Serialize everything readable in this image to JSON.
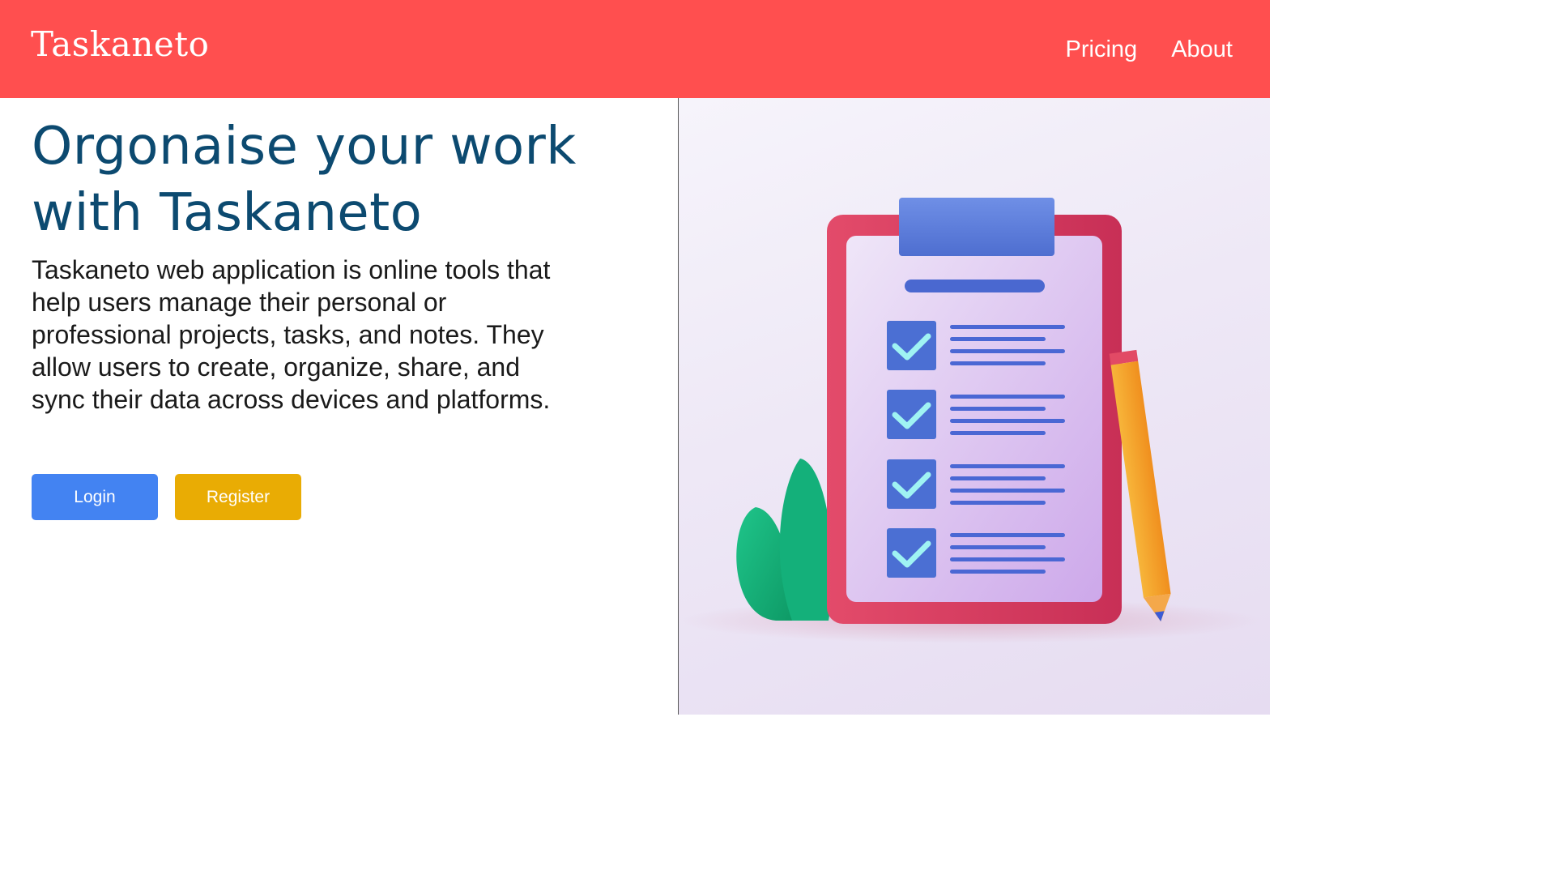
{
  "header": {
    "logo": "Taskaneto",
    "nav": [
      {
        "label": "Pricing"
      },
      {
        "label": "About"
      }
    ]
  },
  "main": {
    "headline": "Orgonaise your work with Taskaneto",
    "description": "Taskaneto web application is online tools that help users manage their personal or professional projects, tasks, and notes. They allow users to create, organize, share, and sync their data across devices and platforms.",
    "buttons": {
      "login": "Login",
      "register": "Register"
    }
  },
  "colors": {
    "header_bg": "#ff4f4f",
    "headline": "#0c4a70",
    "login_button": "#4383f2",
    "register_button": "#e9ac04"
  },
  "illustration": {
    "icons": [
      "clipboard-icon",
      "checkbox-icon",
      "pencil-icon",
      "plant-icon"
    ]
  }
}
